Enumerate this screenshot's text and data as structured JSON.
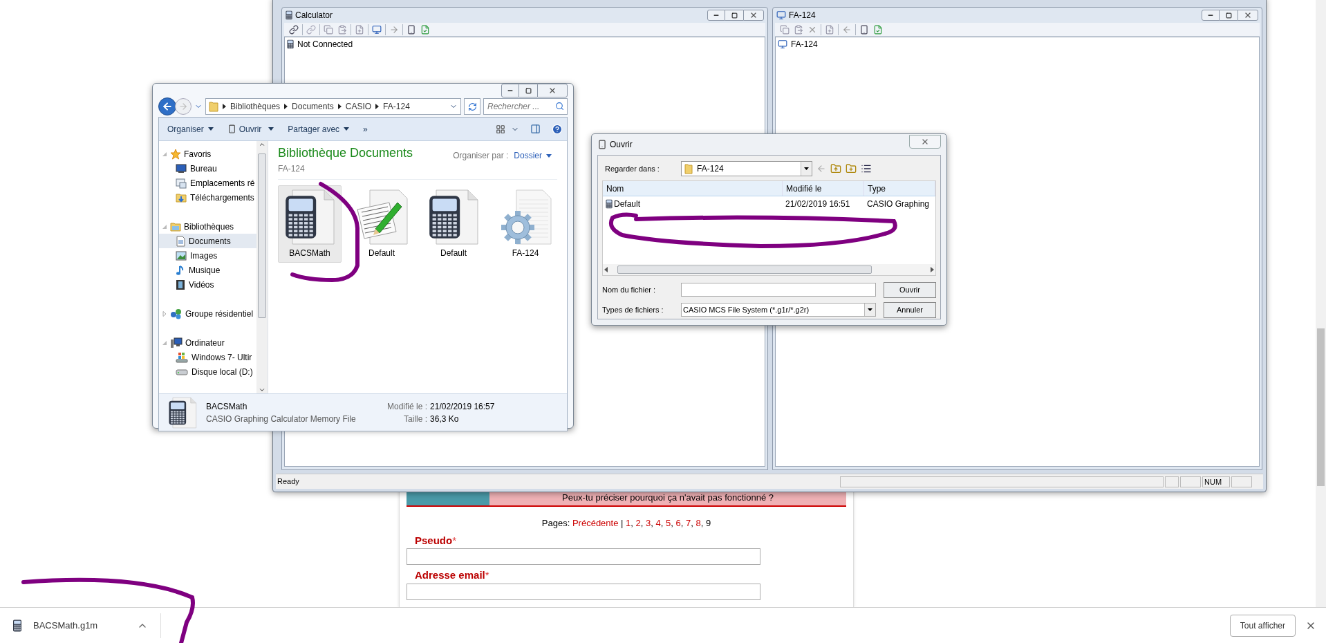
{
  "app_window": {
    "panes": [
      {
        "kind": "calculator",
        "title": "Calculator",
        "items": [
          {
            "kind": "calculator",
            "label": "Not Connected"
          }
        ]
      },
      {
        "kind": "computer",
        "title": "FA-124",
        "items": [
          {
            "kind": "computer",
            "label": "FA-124"
          }
        ]
      }
    ],
    "status_bar": {
      "message": "Ready",
      "indicator": "NUM"
    }
  },
  "explorer": {
    "breadcrumb": [
      "Bibliothèques",
      "Documents",
      "CASIO",
      "FA-124"
    ],
    "search": {
      "placeholder": "Rechercher ..."
    },
    "toolbar": [
      {
        "label": "Organiser",
        "kind": "menu"
      },
      {
        "label": "Ouvrir",
        "kind": "open"
      },
      {
        "label": "Partager avec",
        "kind": "menu"
      },
      {
        "label": "»",
        "kind": "more"
      }
    ],
    "nav": [
      {
        "label": "Favoris",
        "kind": "favorites",
        "expanded": true,
        "selected": false,
        "children": [
          {
            "label": "Bureau",
            "kind": "desktop",
            "selected": false
          },
          {
            "label": "Emplacements ré",
            "kind": "places",
            "selected": false
          },
          {
            "label": "Téléchargements",
            "kind": "downloads",
            "selected": false
          }
        ]
      },
      {
        "label": "Bibliothèques",
        "kind": "libraries",
        "expanded": true,
        "selected": false,
        "children": [
          {
            "label": "Documents",
            "kind": "documents",
            "selected": true
          },
          {
            "label": "Images",
            "kind": "images",
            "selected": false
          },
          {
            "label": "Musique",
            "kind": "music",
            "selected": false
          },
          {
            "label": "Vidéos",
            "kind": "videos",
            "selected": false
          }
        ]
      },
      {
        "label": "Groupe résidentiel",
        "kind": "homegroup",
        "expanded": false,
        "selected": false
      },
      {
        "label": "Ordinateur",
        "kind": "computer",
        "expanded": true,
        "selected": false,
        "children": [
          {
            "label": "Windows 7- Ultir",
            "kind": "windows",
            "selected": false
          },
          {
            "label": "Disque local (D:)",
            "kind": "drive",
            "selected": false
          }
        ]
      }
    ],
    "library": {
      "title": "Bibliothèque Documents",
      "subtitle": "FA-124",
      "arrange_label": "Organiser par :",
      "arrange_value": "Dossier"
    },
    "files": [
      {
        "name": "BACSMath",
        "kind": "calculator",
        "selected": true
      },
      {
        "name": "Default",
        "kind": "text",
        "selected": false
      },
      {
        "name": "Default",
        "kind": "calculator",
        "selected": false
      },
      {
        "name": "FA-124",
        "kind": "settings",
        "selected": false
      }
    ],
    "details": {
      "name": "BACSMath",
      "type": "CASIO Graphing Calculator Memory File",
      "fields": [
        {
          "label": "Modifié le :",
          "value": "21/02/2019 16:57"
        },
        {
          "label": "Taille :",
          "value": "36,3 Ko"
        }
      ]
    }
  },
  "open_dialog": {
    "title": "Ouvrir",
    "look_in_label": "Regarder dans :",
    "look_in_value": "FA-124",
    "columns": [
      "Nom",
      "Modifié le",
      "Type"
    ],
    "rows": [
      {
        "cells": [
          "Default",
          "21/02/2019 16:51",
          "CASIO Graphing"
        ]
      }
    ],
    "file_name_label": "Nom du fichier :",
    "file_type_label": "Types de fichiers :",
    "file_type_value": "CASIO MCS File System (*.g1r/*.g2r)",
    "buttons": [
      "Ouvrir",
      "Annuler"
    ]
  },
  "web_page": {
    "banner_text": "Peux-tu préciser pourquoi ça n'avait pas fonctionné ?",
    "pagination": {
      "label": "Pages:",
      "previous": "Précédente",
      "separator": "|",
      "page_separator": ",",
      "pages": [
        {
          "label": "1",
          "selected": false
        },
        {
          "label": "2",
          "selected": false
        },
        {
          "label": "3",
          "selected": false
        },
        {
          "label": "4",
          "selected": false
        },
        {
          "label": "5",
          "selected": false
        },
        {
          "label": "6",
          "selected": false
        },
        {
          "label": "7",
          "selected": false
        },
        {
          "label": "8",
          "selected": false
        },
        {
          "label": "9",
          "selected": true
        }
      ]
    },
    "form_fields": [
      {
        "label": "Pseudo",
        "mark": "*"
      },
      {
        "label": "Adresse email",
        "mark": "*"
      }
    ]
  },
  "download_bar": {
    "file": "BACSMath.g1m",
    "show_all": "Tout afficher"
  }
}
